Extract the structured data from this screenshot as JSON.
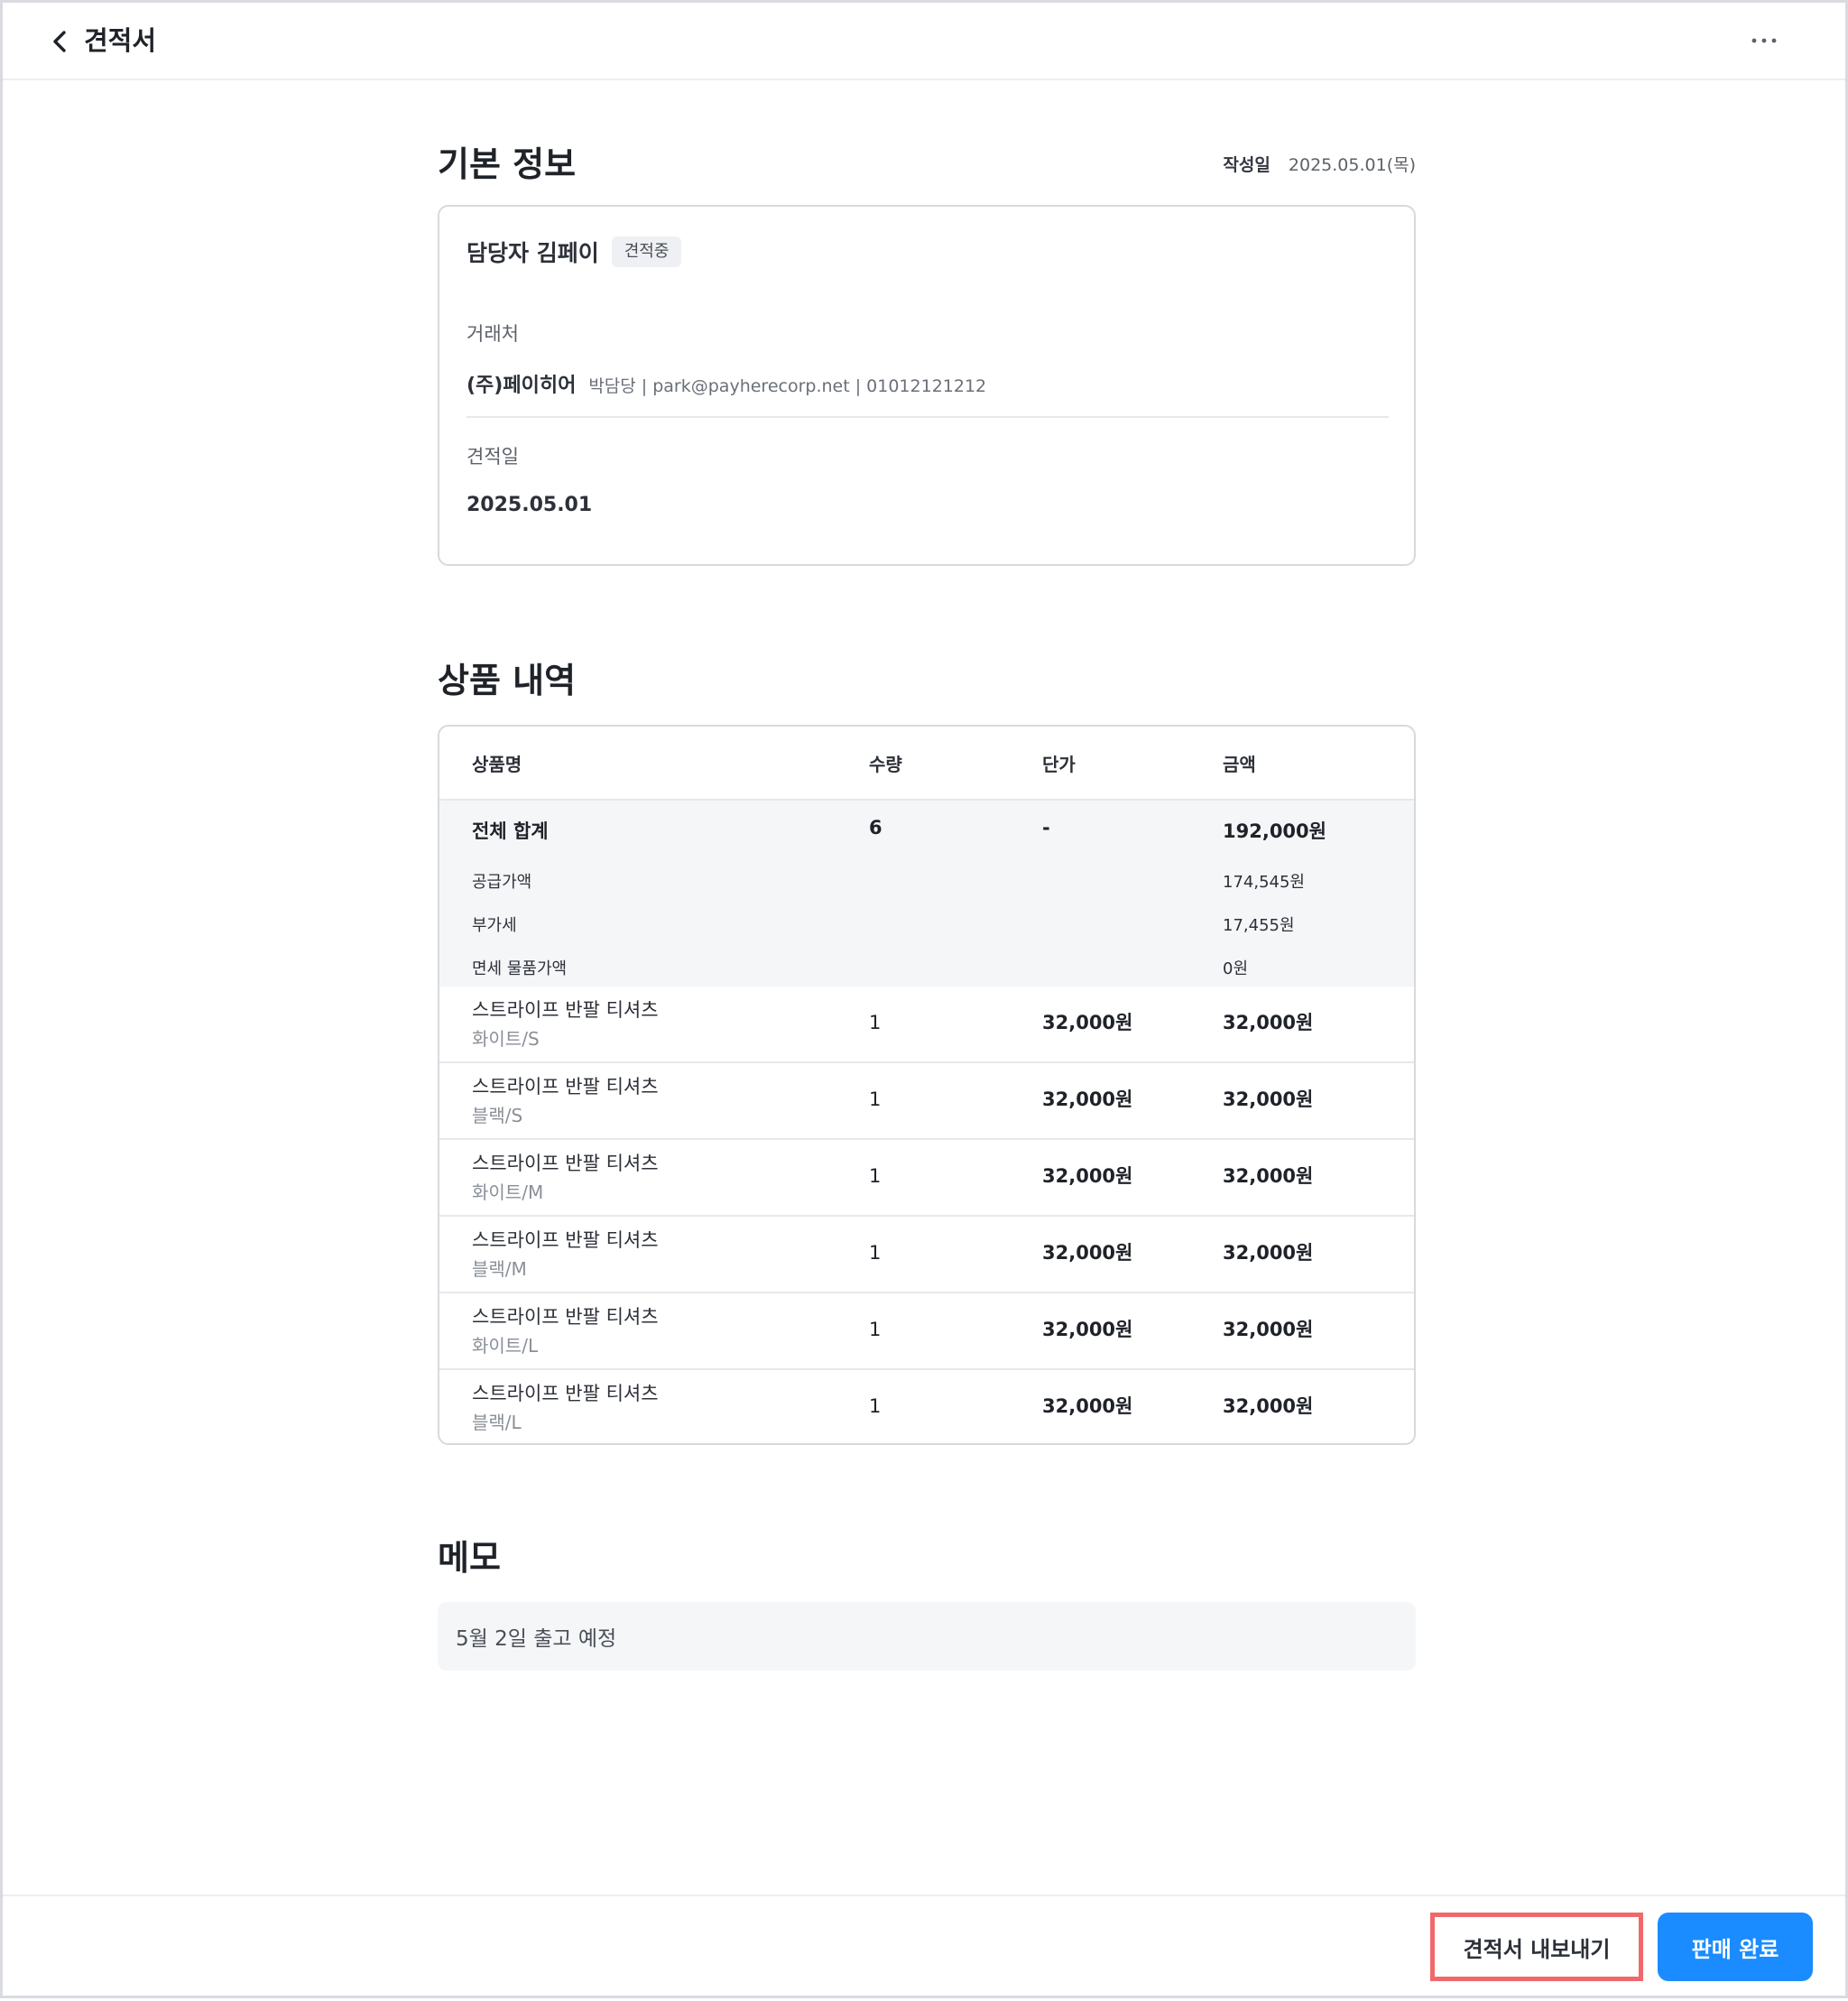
{
  "header": {
    "title": "견적서",
    "back_icon": "chevron-left-icon",
    "more_icon": "more-horizontal-icon"
  },
  "basic_info": {
    "section_title": "기본 정보",
    "created_label": "작성일",
    "created_value": "2025.05.01(목)",
    "manager": "담당자 김페이",
    "status_badge": "견적중",
    "client_label": "거래처",
    "client_name": "(주)페이히어",
    "client_detail": "박담당 | park@payherecorp.net | 01012121212",
    "quote_date_label": "견적일",
    "quote_date_value": "2025.05.01"
  },
  "products": {
    "section_title": "상품 내역",
    "columns": [
      "상품명",
      "수량",
      "단가",
      "금액"
    ],
    "total": {
      "label": "전체 합계",
      "qty": "6",
      "unit_price": "-",
      "amount": "192,000원"
    },
    "sub_totals": [
      {
        "label": "공급가액",
        "amount": "174,545원"
      },
      {
        "label": "부가세",
        "amount": "17,455원"
      },
      {
        "label": "면세 물품가액",
        "amount": "0원"
      }
    ],
    "rows": [
      {
        "name": "스트라이프 반팔 티셔츠",
        "option": "화이트/S",
        "qty": "1",
        "unit_price": "32,000원",
        "amount": "32,000원"
      },
      {
        "name": "스트라이프 반팔 티셔츠",
        "option": "블랙/S",
        "qty": "1",
        "unit_price": "32,000원",
        "amount": "32,000원"
      },
      {
        "name": "스트라이프 반팔 티셔츠",
        "option": "화이트/M",
        "qty": "1",
        "unit_price": "32,000원",
        "amount": "32,000원"
      },
      {
        "name": "스트라이프 반팔 티셔츠",
        "option": "블랙/M",
        "qty": "1",
        "unit_price": "32,000원",
        "amount": "32,000원"
      },
      {
        "name": "스트라이프 반팔 티셔츠",
        "option": "화이트/L",
        "qty": "1",
        "unit_price": "32,000원",
        "amount": "32,000원"
      },
      {
        "name": "스트라이프 반팔 티셔츠",
        "option": "블랙/L",
        "qty": "1",
        "unit_price": "32,000원",
        "amount": "32,000원"
      }
    ]
  },
  "memo": {
    "section_title": "메모",
    "text": "5월 2일 출고 예정"
  },
  "footer": {
    "export_label": "견적서 내보내기",
    "complete_label": "판매 완료"
  },
  "colors": {
    "primary": "#1a8cff",
    "highlight_border": "#f0696a",
    "surface_gray": "#f5f6f8"
  }
}
